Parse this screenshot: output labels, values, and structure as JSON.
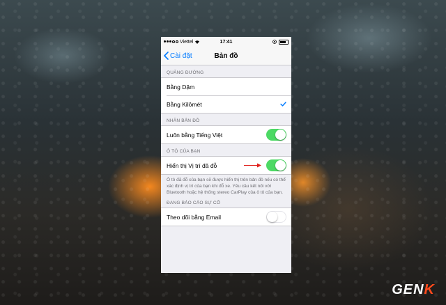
{
  "status_bar": {
    "carrier": "Viettel",
    "time": "17:41"
  },
  "nav": {
    "back_label": "Cài đặt",
    "title": "Bản đồ"
  },
  "sections": {
    "distance": {
      "header": "QUÃNG ĐƯỜNG",
      "items": [
        {
          "label": "Bằng Dặm",
          "selected": false
        },
        {
          "label": "Bằng Kilômét",
          "selected": true
        }
      ]
    },
    "map_labels": {
      "header": "NHÃN BẢN ĐỒ",
      "item": {
        "label": "Luôn bằng Tiếng Việt",
        "on": true
      }
    },
    "your_car": {
      "header": "Ô TÔ CỦA BẠN",
      "item": {
        "label": "Hiển thị Vị trí đã đỗ",
        "on": true
      },
      "footer": "Ô tô đã đỗ của bạn sẽ được hiển thị trên bản đồ nếu có thể xác định vị trí của bạn khi đỗ xe. Yêu cầu kết nối với Bluetooth hoặc hệ thống stereo CarPlay của ô tô của bạn."
    },
    "report": {
      "header": "ĐANG BÁO CÁO SỰ CỐ",
      "item": {
        "label": "Theo dõi bằng Email",
        "on": false
      }
    }
  },
  "watermark": {
    "text": "GEN",
    "accent": "K"
  },
  "colors": {
    "ios_blue": "#007aff",
    "toggle_green": "#4cd964",
    "annotation_arrow": "#e0201b"
  },
  "icons": [
    "chevron-left-icon",
    "checkmark-icon",
    "wifi-icon",
    "location-icon",
    "battery-icon",
    "red-arrow-icon"
  ]
}
